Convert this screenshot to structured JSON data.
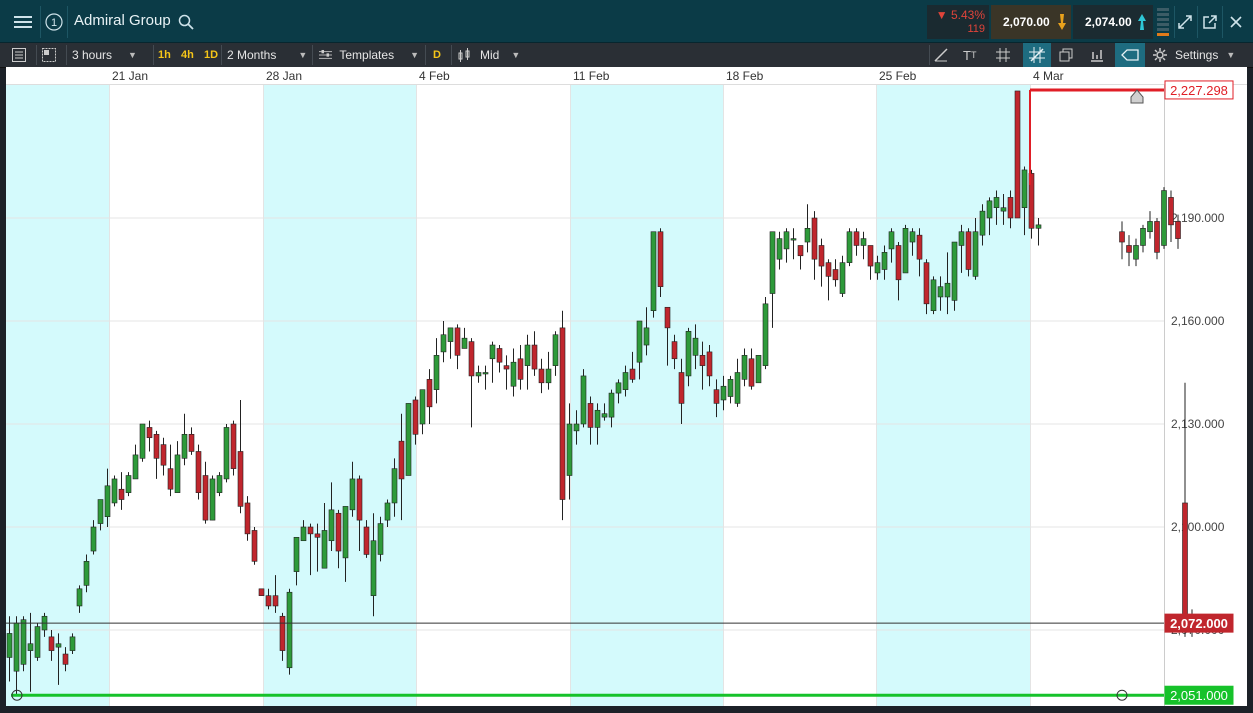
{
  "titlebar": {
    "title": "Admiral Group",
    "change_pct": "▼ 5.43%",
    "change_points": "119",
    "sell_price": "2,070.00",
    "buy_price": "2,074.00",
    "info_label": "1"
  },
  "toolbar": {
    "interval": "3 hours",
    "quick_intervals": [
      "1h",
      "4h",
      "1D"
    ],
    "period": "2 Months",
    "templates_label": "Templates",
    "d_label": "D",
    "price_type": "Mid",
    "settings_label": "Settings"
  },
  "colors": {
    "up": "#2e9a3a",
    "down": "#c0262d",
    "shade": "#d4fafc",
    "resistance": "#e01e26",
    "support": "#16c22a",
    "titlebar": "#0b3b47"
  },
  "chart_data": {
    "type": "candlestick",
    "x_tick_labels": [
      "21 Jan",
      "28 Jan",
      "4 Feb",
      "11 Feb",
      "18 Feb",
      "25 Feb",
      "4 Mar"
    ],
    "y_tick_labels": [
      "2,190.000",
      "2,160.000",
      "2,130.000",
      "2,100.000",
      "2,070.000"
    ],
    "y_ticks": [
      2190,
      2160,
      2130,
      2100,
      2070
    ],
    "ylim": [
      2042.5,
      2230
    ],
    "levels": [
      {
        "label": "2,227.298",
        "value": 2227.298,
        "role": "resistance"
      },
      {
        "label": "2,072.000",
        "value": 2072.0,
        "role": "current"
      },
      {
        "label": "2,051.000",
        "value": 2051.0,
        "role": "support"
      }
    ],
    "grid": true,
    "candles": [
      [
        2062,
        2069,
        2055,
        2074
      ],
      [
        2058,
        2072,
        2051,
        2074
      ],
      [
        2060,
        2073,
        2058,
        2074
      ],
      [
        2064,
        2066,
        2052,
        2075
      ],
      [
        2062,
        2071,
        2061,
        2072
      ],
      [
        2070,
        2074,
        2068,
        2075
      ],
      [
        2068,
        2064,
        2061,
        2070
      ],
      [
        2065,
        2066,
        2054,
        2069
      ],
      [
        2063,
        2060,
        2058,
        2065
      ],
      [
        2064,
        2068,
        2063,
        2069
      ],
      [
        2077,
        2082,
        2075,
        2083
      ],
      [
        2083,
        2090,
        2081,
        2092
      ],
      [
        2093,
        2100,
        2092,
        2102
      ],
      [
        2101,
        2108,
        2099,
        2108
      ],
      [
        2103,
        2112,
        2100,
        2117
      ],
      [
        2107,
        2114,
        2106,
        2115
      ],
      [
        2111,
        2108,
        2105,
        2116
      ],
      [
        2110,
        2115,
        2109,
        2116
      ],
      [
        2114,
        2121,
        2114,
        2124
      ],
      [
        2120,
        2130,
        2119,
        2130
      ],
      [
        2129,
        2126,
        2122,
        2131
      ],
      [
        2127,
        2120,
        2114,
        2128
      ],
      [
        2124,
        2118,
        2115,
        2126
      ],
      [
        2117,
        2111,
        2109,
        2124
      ],
      [
        2110,
        2121,
        2110,
        2125
      ],
      [
        2120,
        2127,
        2118,
        2133
      ],
      [
        2127,
        2122,
        2121,
        2129
      ],
      [
        2122,
        2110,
        2108,
        2124
      ],
      [
        2115,
        2102,
        2101,
        2119
      ],
      [
        2102,
        2114,
        2102,
        2115
      ],
      [
        2110,
        2115,
        2109,
        2116
      ],
      [
        2114,
        2129,
        2113,
        2130
      ],
      [
        2130,
        2117,
        2115,
        2131
      ],
      [
        2122,
        2106,
        2104,
        2137
      ],
      [
        2107,
        2098,
        2096,
        2109
      ],
      [
        2099,
        2090,
        2089,
        2100
      ],
      [
        2082,
        2080,
        2080,
        2082
      ],
      [
        2080,
        2077,
        2076,
        2082
      ],
      [
        2080,
        2077,
        2075,
        2086
      ],
      [
        2074,
        2064,
        2061,
        2075
      ],
      [
        2059,
        2081,
        2057,
        2082
      ],
      [
        2087,
        2097,
        2083,
        2097
      ],
      [
        2096,
        2100,
        2096,
        2102
      ],
      [
        2100,
        2098,
        2086,
        2101
      ],
      [
        2098,
        2097,
        2087,
        2101
      ],
      [
        2088,
        2099,
        2088,
        2107
      ],
      [
        2096,
        2105,
        2093,
        2113
      ],
      [
        2104,
        2093,
        2088,
        2105
      ],
      [
        2091,
        2106,
        2084,
        2106
      ],
      [
        2105,
        2114,
        2103,
        2119
      ],
      [
        2114,
        2102,
        2093,
        2115
      ],
      [
        2100,
        2092,
        2091,
        2102
      ],
      [
        2080,
        2096,
        2074,
        2104
      ],
      [
        2092,
        2101,
        2090,
        2103
      ],
      [
        2102,
        2107,
        2100,
        2108
      ],
      [
        2107,
        2117,
        2103,
        2120
      ],
      [
        2125,
        2114,
        2102,
        2133
      ],
      [
        2115,
        2136,
        2115,
        2136
      ],
      [
        2137,
        2127,
        2124,
        2138
      ],
      [
        2130,
        2140,
        2127,
        2140
      ],
      [
        2143,
        2135,
        2130,
        2146
      ],
      [
        2140,
        2150,
        2136,
        2155
      ],
      [
        2151,
        2156,
        2148,
        2160
      ],
      [
        2154,
        2158,
        2149,
        2158
      ],
      [
        2158,
        2150,
        2146,
        2159
      ],
      [
        2152,
        2155,
        2152,
        2158
      ],
      [
        2154,
        2144,
        2129,
        2155
      ],
      [
        2144,
        2145,
        2142,
        2147
      ],
      [
        2145,
        2145,
        2140,
        2147
      ],
      [
        2149,
        2153,
        2142,
        2154
      ],
      [
        2152,
        2148,
        2145,
        2153
      ],
      [
        2147,
        2146,
        2140,
        2150
      ],
      [
        2141,
        2148,
        2138,
        2152
      ],
      [
        2149,
        2143,
        2140,
        2153
      ],
      [
        2147,
        2153,
        2140,
        2156
      ],
      [
        2153,
        2146,
        2144,
        2157
      ],
      [
        2146,
        2142,
        2139,
        2149
      ],
      [
        2142,
        2146,
        2140,
        2151
      ],
      [
        2147,
        2156,
        2144,
        2157
      ],
      [
        2158,
        2108,
        2102,
        2163
      ],
      [
        2115,
        2130,
        2108,
        2136
      ],
      [
        2128,
        2130,
        2124,
        2134
      ],
      [
        2130,
        2144,
        2129,
        2146
      ],
      [
        2136,
        2129,
        2124,
        2138
      ],
      [
        2129,
        2134,
        2124,
        2136
      ],
      [
        2132,
        2133,
        2131,
        2136
      ],
      [
        2132,
        2139,
        2129,
        2140
      ],
      [
        2139,
        2142,
        2136,
        2143
      ],
      [
        2140,
        2145,
        2138,
        2147
      ],
      [
        2146,
        2143,
        2142,
        2151
      ],
      [
        2148,
        2160,
        2143,
        2160
      ],
      [
        2153,
        2158,
        2150,
        2164
      ],
      [
        2163,
        2186,
        2161,
        2186
      ],
      [
        2186,
        2170,
        2167,
        2187
      ],
      [
        2164,
        2158,
        2147,
        2164
      ],
      [
        2154,
        2149,
        2146,
        2156
      ],
      [
        2145,
        2136,
        2130,
        2149
      ],
      [
        2144,
        2157,
        2141,
        2158
      ],
      [
        2150,
        2155,
        2146,
        2159
      ],
      [
        2150,
        2147,
        2140,
        2154
      ],
      [
        2151,
        2144,
        2141,
        2153
      ],
      [
        2140,
        2136,
        2132,
        2143
      ],
      [
        2137,
        2141,
        2134,
        2144
      ],
      [
        2138,
        2143,
        2136,
        2144
      ],
      [
        2136,
        2145,
        2135,
        2149
      ],
      [
        2143,
        2150,
        2141,
        2152
      ],
      [
        2149,
        2141,
        2140,
        2152
      ],
      [
        2142,
        2150,
        2142,
        2150
      ],
      [
        2147,
        2165,
        2146,
        2167
      ],
      [
        2168,
        2186,
        2158,
        2186
      ],
      [
        2178,
        2184,
        2175,
        2186
      ],
      [
        2181,
        2186,
        2177,
        2187
      ],
      [
        2184,
        2184,
        2178,
        2187
      ],
      [
        2182,
        2179,
        2175,
        2182
      ],
      [
        2183,
        2187,
        2180,
        2194
      ],
      [
        2190,
        2178,
        2172,
        2192
      ],
      [
        2182,
        2176,
        2170,
        2184
      ],
      [
        2177,
        2173,
        2166,
        2178
      ],
      [
        2175,
        2172,
        2170,
        2178
      ],
      [
        2168,
        2177,
        2167,
        2179
      ],
      [
        2177,
        2186,
        2176,
        2187
      ],
      [
        2186,
        2182,
        2179,
        2187
      ],
      [
        2182,
        2184,
        2178,
        2186
      ],
      [
        2182,
        2176,
        2172,
        2182
      ],
      [
        2174,
        2177,
        2172,
        2179
      ],
      [
        2175,
        2180,
        2172,
        2182
      ],
      [
        2181,
        2186,
        2177,
        2187
      ],
      [
        2182,
        2172,
        2166,
        2183
      ],
      [
        2174,
        2187,
        2174,
        2188
      ],
      [
        2183,
        2186,
        2179,
        2187
      ],
      [
        2185,
        2178,
        2173,
        2187
      ],
      [
        2177,
        2165,
        2162,
        2178
      ],
      [
        2163,
        2172,
        2162,
        2173
      ],
      [
        2167,
        2170,
        2163,
        2173
      ],
      [
        2167,
        2171,
        2162,
        2180
      ],
      [
        2166,
        2183,
        2163,
        2183
      ],
      [
        2182,
        2186,
        2174,
        2188
      ],
      [
        2186,
        2175,
        2173,
        2187
      ],
      [
        2173,
        2186,
        2172,
        2190
      ],
      [
        2185,
        2192,
        2182,
        2194
      ],
      [
        2190,
        2195,
        2185,
        2196
      ],
      [
        2193,
        2196,
        2188,
        2198
      ],
      [
        2192,
        2193,
        2188,
        2197
      ],
      [
        2196,
        2190,
        2187,
        2198
      ],
      [
        2227,
        2190,
        2190,
        2227
      ],
      [
        2193,
        2204,
        2185,
        2205
      ],
      [
        2203,
        2187,
        2184,
        2204
      ],
      [
        2187,
        2188,
        2182,
        2190
      ],
      [
        2186,
        2183,
        2178,
        2189
      ],
      [
        2182,
        2180,
        2176,
        2185
      ],
      [
        2178,
        2182,
        2176,
        2184
      ],
      [
        2182,
        2187,
        2180,
        2188
      ],
      [
        2186,
        2189,
        2184,
        2192
      ],
      [
        2189,
        2180,
        2178,
        2190
      ],
      [
        2182,
        2198,
        2181,
        2199
      ],
      [
        2196,
        2188,
        2183,
        2198
      ],
      [
        2189,
        2184,
        2181,
        2191
      ],
      [
        2107,
        2072,
        2068,
        2142
      ],
      [
        2071,
        2074,
        2068,
        2076
      ]
    ]
  }
}
